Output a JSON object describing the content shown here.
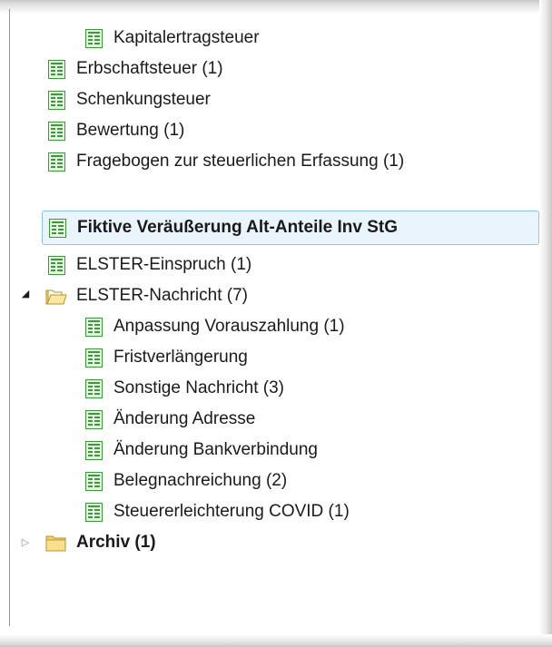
{
  "tree": {
    "items": [
      {
        "label": "Kapitalertragsteuer",
        "icon": "form-document-icon"
      },
      {
        "label": "Erbschaftsteuer (1)",
        "icon": "form-document-icon"
      },
      {
        "label": "Schenkungsteuer",
        "icon": "form-document-icon"
      },
      {
        "label": "Bewertung (1)",
        "icon": "form-document-icon"
      },
      {
        "label": "Fragebogen zur steuerlichen Erfassung (1)",
        "icon": "form-document-icon"
      },
      {
        "label": "Fiktive Veräußerung Alt-Anteile Inv StG",
        "icon": "form-document-icon",
        "selected": true
      },
      {
        "label": "ELSTER-Einspruch (1)",
        "icon": "form-document-icon"
      },
      {
        "label": "ELSTER-Nachricht (7)",
        "icon": "open-folder-icon",
        "expanded": true
      },
      {
        "label": "Anpassung Vorauszahlung (1)",
        "icon": "form-document-icon"
      },
      {
        "label": "Fristverlängerung",
        "icon": "form-document-icon"
      },
      {
        "label": "Sonstige Nachricht (3)",
        "icon": "form-document-icon"
      },
      {
        "label": "Änderung Adresse",
        "icon": "form-document-icon"
      },
      {
        "label": "Änderung Bankverbindung",
        "icon": "form-document-icon"
      },
      {
        "label": "Belegnachreichung (2)",
        "icon": "form-document-icon"
      },
      {
        "label": "Steuererleichterung COVID (1)",
        "icon": "form-document-icon"
      },
      {
        "label": "Archiv (1)",
        "icon": "closed-folder-icon",
        "expanded": false
      }
    ]
  },
  "colors": {
    "selection_bg": "#eaf4fc",
    "selection_border": "#8ec3ea",
    "doc_icon_green": "#2e9a2e",
    "folder_yellow": "#e8c34a"
  }
}
